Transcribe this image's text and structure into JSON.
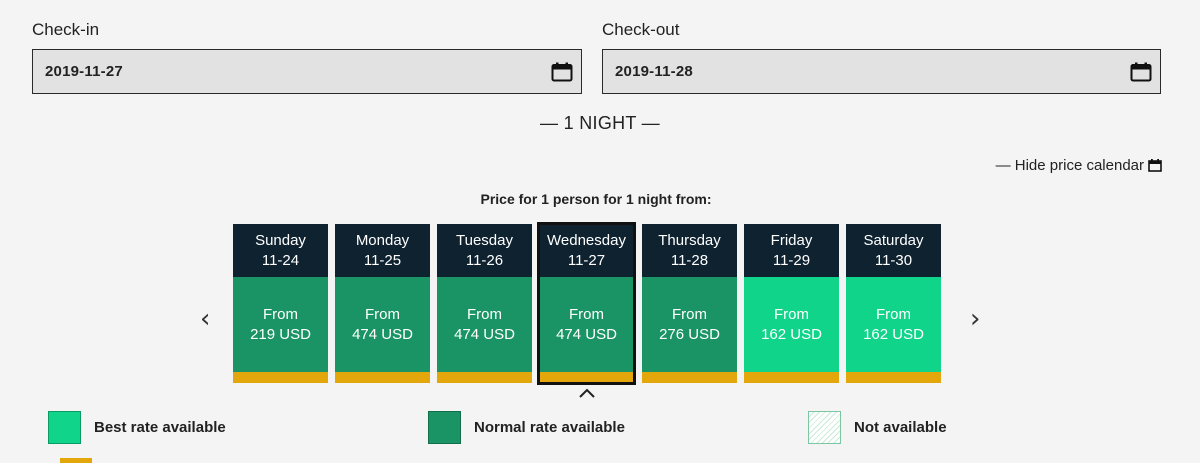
{
  "checkin": {
    "label": "Check-in",
    "value": "2019-11-27"
  },
  "checkout": {
    "label": "Check-out",
    "value": "2019-11-28"
  },
  "nights_label": "— 1 NIGHT —",
  "hide_calendar_label": "— Hide price calendar",
  "price_heading": "Price for 1 person for 1 night from:",
  "days": [
    {
      "day": "Sunday",
      "date": "11-24",
      "from": "From",
      "price": "219 USD",
      "rate": "normal"
    },
    {
      "day": "Monday",
      "date": "11-25",
      "from": "From",
      "price": "474 USD",
      "rate": "normal"
    },
    {
      "day": "Tuesday",
      "date": "11-26",
      "from": "From",
      "price": "474 USD",
      "rate": "normal"
    },
    {
      "day": "Wednesday",
      "date": "11-27",
      "from": "From",
      "price": "474 USD",
      "rate": "normal",
      "selected": true
    },
    {
      "day": "Thursday",
      "date": "11-28",
      "from": "From",
      "price": "276 USD",
      "rate": "normal"
    },
    {
      "day": "Friday",
      "date": "11-29",
      "from": "From",
      "price": "162 USD",
      "rate": "best"
    },
    {
      "day": "Saturday",
      "date": "11-30",
      "from": "From",
      "price": "162 USD",
      "rate": "best"
    }
  ],
  "nav": {
    "prev_icon": "chevron-left-icon",
    "next_icon": "chevron-right-icon",
    "prev": "‹",
    "next": "›"
  },
  "legend": {
    "best": "Best rate available",
    "normal": "Normal rate available",
    "na": "Not available"
  },
  "colors": {
    "best": "#10d48a",
    "normal": "#1a9465",
    "header": "#0f2230",
    "bar": "#e3a70c"
  }
}
